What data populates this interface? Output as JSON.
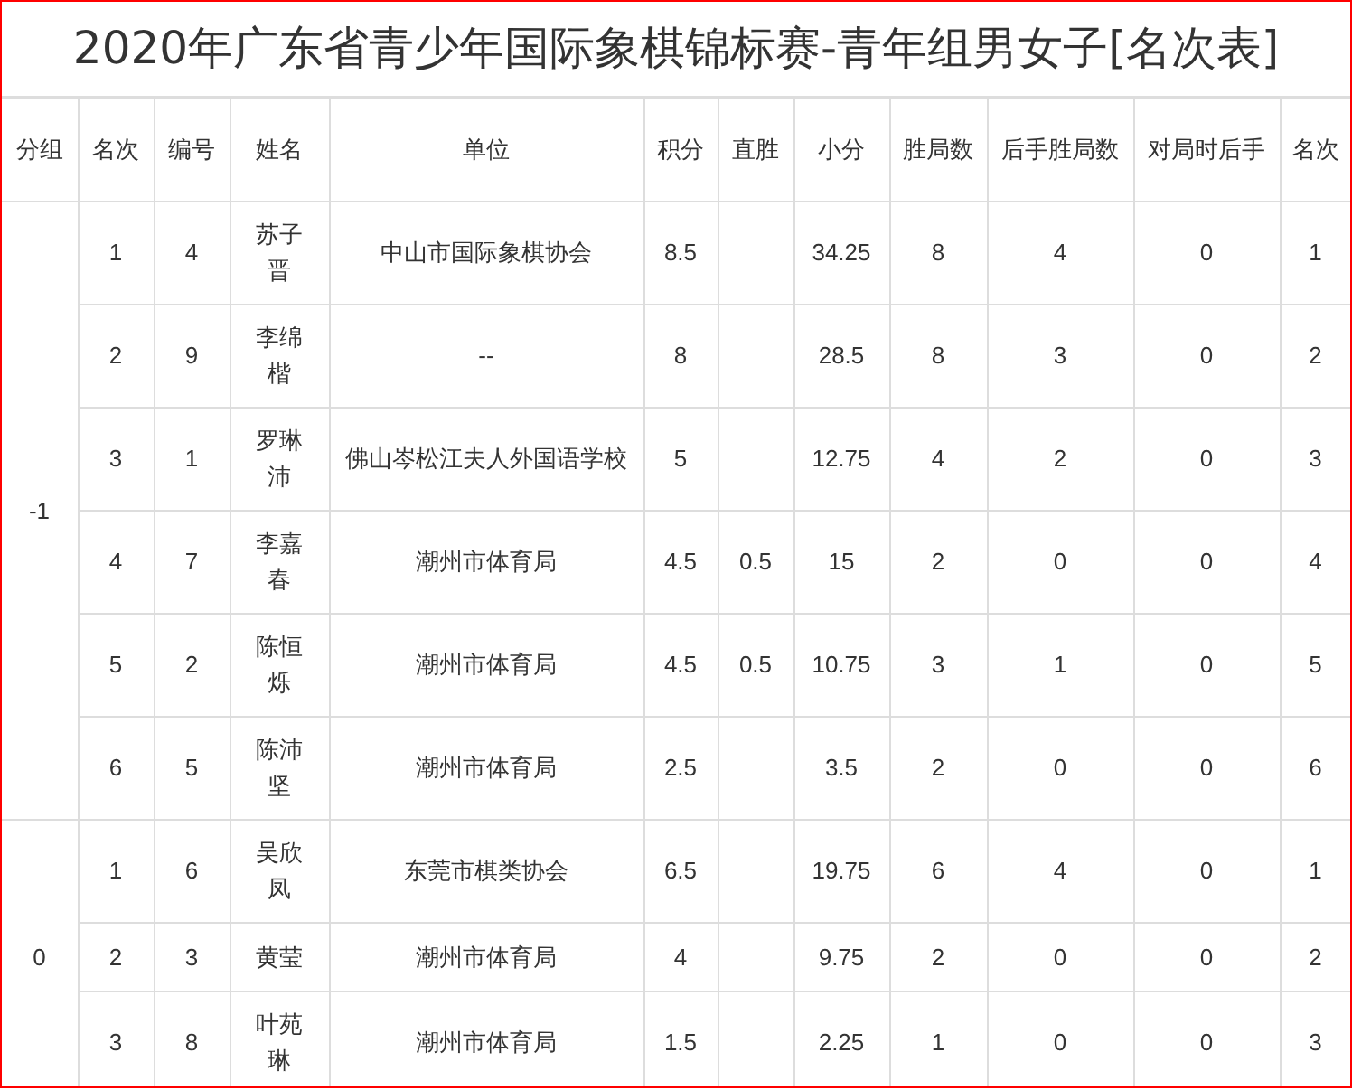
{
  "title": "2020年广东省青少年国际象棋锦标赛-青年组男女子[名次表]",
  "columns": [
    "分组",
    "名次",
    "编号",
    "姓名",
    "单位",
    "积分",
    "直胜",
    "小分",
    "胜局数",
    "后手胜局数",
    "对局时后手",
    "名次"
  ],
  "groups": [
    {
      "group": "-1",
      "rows": [
        {
          "rank": "1",
          "number": "4",
          "name": "苏子晋",
          "unit": "中山市国际象棋协会",
          "points": "8.5",
          "tiebreak": "34.25",
          "wins": "8",
          "black_wins": "4",
          "black_games": "0",
          "place": "1"
        },
        {
          "rank": "2",
          "number": "9",
          "name": "李绵楷",
          "unit": "--",
          "points": "8",
          "tiebreak": "28.5",
          "wins": "8",
          "black_wins": "3",
          "black_games": "0",
          "place": "2"
        },
        {
          "rank": "3",
          "number": "1",
          "name": "罗琳沛",
          "unit": "佛山岑松江夫人外国语学校",
          "points": "5",
          "tiebreak": "12.75",
          "wins": "4",
          "black_wins": "2",
          "black_games": "0",
          "place": "3"
        },
        {
          "rank": "4",
          "number": "7",
          "name": "李嘉春",
          "unit": "潮州市体育局",
          "points": "4.5",
          "direct": "0.5",
          "tiebreak": "15",
          "wins": "2",
          "black_wins": "0",
          "black_games": "0",
          "place": "4"
        },
        {
          "rank": "5",
          "number": "2",
          "name": "陈恒烁",
          "unit": "潮州市体育局",
          "points": "4.5",
          "direct": "0.5",
          "tiebreak": "10.75",
          "wins": "3",
          "black_wins": "1",
          "black_games": "0",
          "place": "5"
        },
        {
          "rank": "6",
          "number": "5",
          "name": "陈沛坚",
          "unit": "潮州市体育局",
          "points": "2.5",
          "tiebreak": "3.5",
          "wins": "2",
          "black_wins": "0",
          "black_games": "0",
          "place": "6"
        }
      ]
    },
    {
      "group": "0",
      "rows": [
        {
          "rank": "1",
          "number": "6",
          "name": "吴欣凤",
          "unit": "东莞市棋类协会",
          "points": "6.5",
          "tiebreak": "19.75",
          "wins": "6",
          "black_wins": "4",
          "black_games": "0",
          "place": "1"
        },
        {
          "rank": "2",
          "number": "3",
          "name": "黄莹",
          "unit": "潮州市体育局",
          "points": "4",
          "tiebreak": "9.75",
          "wins": "2",
          "black_wins": "0",
          "black_games": "0",
          "place": "2"
        },
        {
          "rank": "3",
          "number": "8",
          "name": "叶苑琳",
          "unit": "潮州市体育局",
          "points": "1.5",
          "tiebreak": "2.25",
          "wins": "1",
          "black_wins": "0",
          "black_games": "0",
          "place": "3"
        }
      ]
    }
  ]
}
